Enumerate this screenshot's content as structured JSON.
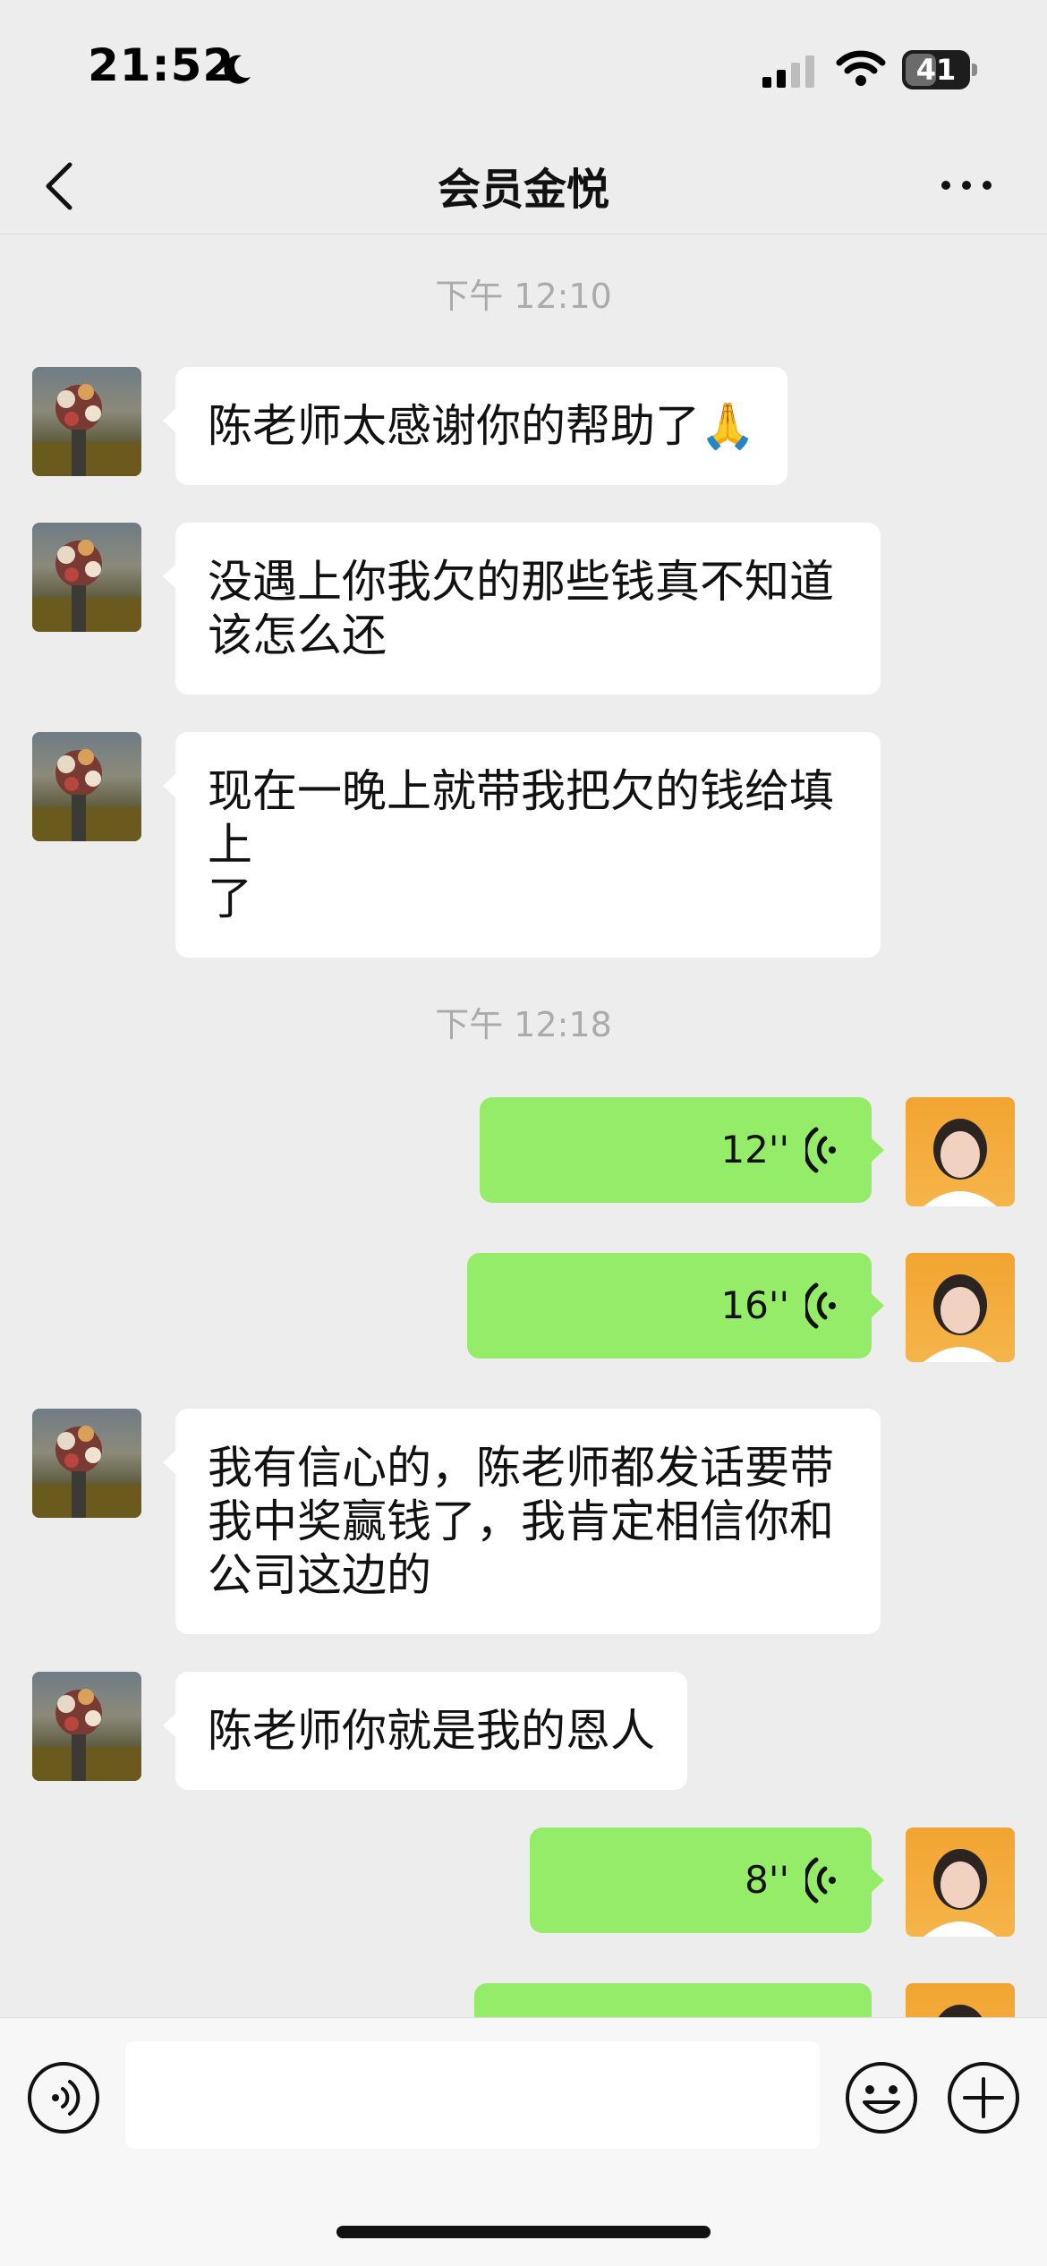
{
  "status_bar": {
    "time": "21:52",
    "battery": "41",
    "icons": [
      "moon-icon",
      "signal-icon",
      "wifi-icon",
      "battery-icon"
    ]
  },
  "nav": {
    "title": "会员金悦",
    "back_icon": "chevron-left-icon",
    "more_icon": "more-icon"
  },
  "chat": {
    "timestamps": [
      "下午 12:10",
      "下午 12:18"
    ],
    "messages": [
      {
        "side": "in",
        "type": "text",
        "lines": [
          "陈老师太感谢你的帮助了🙏"
        ]
      },
      {
        "side": "in",
        "type": "text",
        "lines": [
          "没遇上你我欠的那些钱真不知道",
          "该怎么还"
        ]
      },
      {
        "side": "in",
        "type": "text",
        "lines": [
          "现在一晚上就带我把欠的钱给填",
          "上",
          "了"
        ]
      },
      {
        "side": "out",
        "type": "voice",
        "duration": "12''"
      },
      {
        "side": "out",
        "type": "voice",
        "duration": "16''"
      },
      {
        "side": "in",
        "type": "text",
        "lines": [
          "我有信心的，陈老师都发话要带",
          "我中奖赢钱了，我肯定相信你和",
          "公司这边的"
        ]
      },
      {
        "side": "in",
        "type": "text",
        "lines": [
          "陈老师你就是我的恩人"
        ]
      },
      {
        "side": "out",
        "type": "voice",
        "duration": "8''"
      },
      {
        "side": "out",
        "type": "voice",
        "duration": ""
      }
    ]
  },
  "input_bar": {
    "voice_icon": "voice-mode-icon",
    "emoji_icon": "emoji-icon",
    "plus_icon": "plus-icon",
    "input_value": ""
  },
  "colors": {
    "background": "#EDEDED",
    "incoming_bubble": "#FFFFFF",
    "outgoing_bubble": "#95EC69",
    "timestamp": "#ABABAB"
  }
}
